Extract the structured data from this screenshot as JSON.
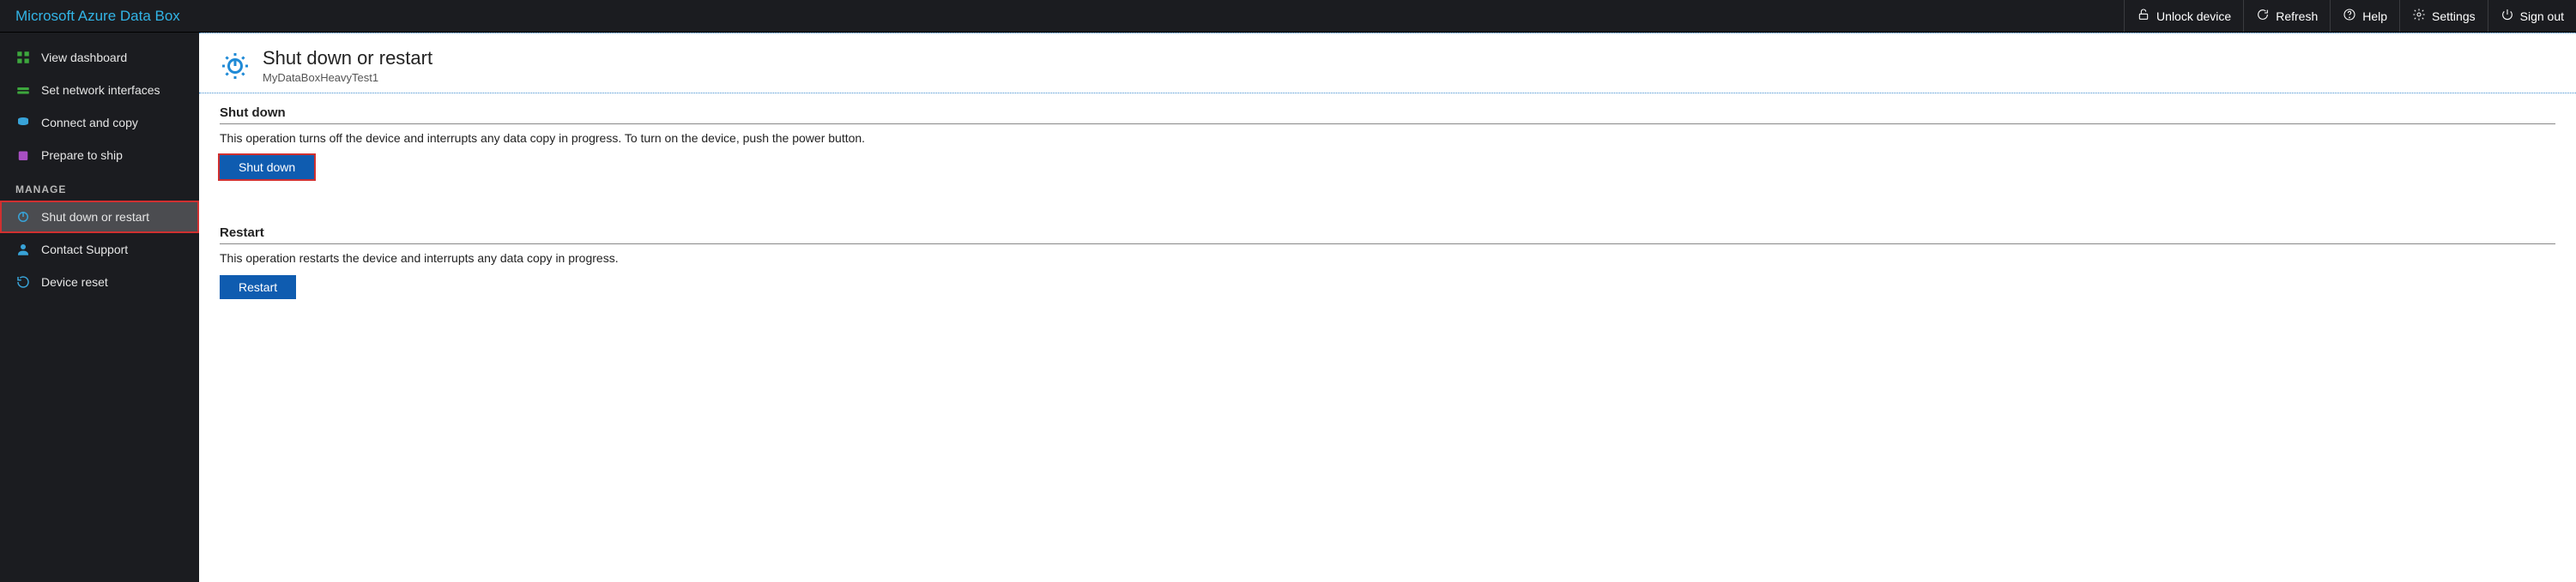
{
  "brand": "Microsoft Azure Data Box",
  "top_actions": {
    "unlock": "Unlock device",
    "refresh": "Refresh",
    "help": "Help",
    "settings": "Settings",
    "signout": "Sign out"
  },
  "sidebar": {
    "items": [
      {
        "label": "View dashboard"
      },
      {
        "label": "Set network interfaces"
      },
      {
        "label": "Connect and copy"
      },
      {
        "label": "Prepare to ship"
      }
    ],
    "section_label": "MANAGE",
    "manage_items": [
      {
        "label": "Shut down or restart"
      },
      {
        "label": "Contact Support"
      },
      {
        "label": "Device reset"
      }
    ]
  },
  "page": {
    "title": "Shut down or restart",
    "subtitle": "MyDataBoxHeavyTest1"
  },
  "shutdown": {
    "heading": "Shut down",
    "desc": "This operation turns off the device and interrupts any data copy in progress. To turn on the device, push the power button.",
    "button": "Shut down"
  },
  "restart": {
    "heading": "Restart",
    "desc": "This operation restarts the device and interrupts any data copy in progress.",
    "button": "Restart"
  }
}
